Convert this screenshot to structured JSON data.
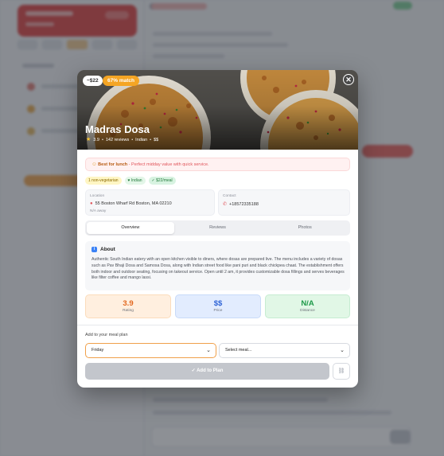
{
  "restaurant": {
    "name": "Madras Dosa",
    "price_badge": "~$22",
    "match_badge": "67% match",
    "rating": "3.9",
    "reviews": "142 reviews",
    "cuisine": "Indian",
    "price_level": "$$"
  },
  "best_for": {
    "label": "Best for lunch",
    "text": " - Perfect midday value with quick service."
  },
  "tags": [
    "1 non-vegetarian",
    "♥ Indian",
    "✓ $22/meal"
  ],
  "location": {
    "label": "Location",
    "address": "55 Boston Wharf Rd Boston, MA 02210",
    "distance": "N/A away"
  },
  "contact": {
    "label": "Contact",
    "phone": "+18572335188"
  },
  "tabs": [
    "Overview",
    "Reviews",
    "Photos"
  ],
  "about": {
    "title": "About",
    "text": "Authentic South Indian eatery with an open kitchen visible to diners, where dosas are prepared live. The menu includes a variety of dosas such as Pav Bhaji Dosa and Samosa Dosa, along with Indian street food like pani puri and black chickpea chaat. The establishment offers both indoor and outdoor seating, focusing on takeout service. Open until 2 am, it provides customizable dosa fillings and serves beverages like filter coffee and mango lassi."
  },
  "stats": [
    {
      "value": "3.9",
      "label": "Rating"
    },
    {
      "value": "$$",
      "label": "Price"
    },
    {
      "value": "N/A",
      "label": "Distance"
    }
  ],
  "meal_plan": {
    "label": "Add to your meal plan",
    "day": "Friday",
    "meal_placeholder": "Select meal...",
    "add_label": "✓ Add to Plan"
  },
  "colors": {
    "accent": "#f5a524",
    "best_for_label": "#b75a11",
    "rating": "#e2671e",
    "price": "#2f64d6",
    "distance": "#1f9a4a"
  },
  "icons": {
    "close": "close-icon",
    "star": "star-icon",
    "pin": "map-pin-icon",
    "phone": "phone-icon",
    "info": "info-icon",
    "chevron": "chevron-down-icon",
    "link": "link-icon"
  }
}
